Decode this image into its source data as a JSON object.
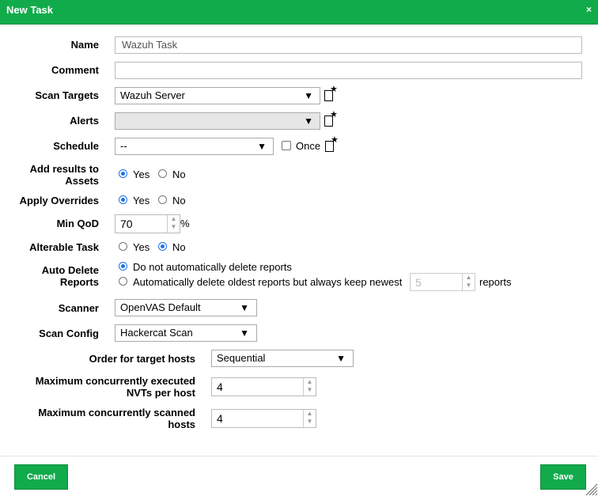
{
  "dialog": {
    "title": "New Task",
    "close_glyph": "×"
  },
  "form": {
    "name": {
      "label": "Name",
      "value": "Wazuh Task"
    },
    "comment": {
      "label": "Comment",
      "value": ""
    },
    "scan_targets": {
      "label": "Scan Targets",
      "selected": "Wazuh Server"
    },
    "alerts": {
      "label": "Alerts",
      "selected": ""
    },
    "schedule": {
      "label": "Schedule",
      "selected": "--",
      "once_label": "Once",
      "once_checked": false
    },
    "add_results": {
      "label_line1": "Add results to",
      "label_line2": "Assets",
      "yes": "Yes",
      "no": "No",
      "selected": "Yes"
    },
    "apply_overrides": {
      "label": "Apply Overrides",
      "yes": "Yes",
      "no": "No",
      "selected": "Yes"
    },
    "min_qod": {
      "label": "Min QoD",
      "value": "70",
      "unit": "%"
    },
    "alterable_task": {
      "label": "Alterable Task",
      "yes": "Yes",
      "no": "No",
      "selected": "No"
    },
    "auto_delete": {
      "label_line1": "Auto Delete",
      "label_line2": "Reports",
      "option1": "Do not automatically delete reports",
      "option2": "Automatically delete oldest reports but always keep newest",
      "keep_value": "5",
      "suffix": "reports",
      "selected": "option1"
    },
    "scanner": {
      "label": "Scanner",
      "selected": "OpenVAS Default"
    },
    "scan_config": {
      "label": "Scan Config",
      "selected": "Hackercat Scan"
    },
    "order_hosts": {
      "label": "Order for target hosts",
      "selected": "Sequential"
    },
    "max_nvts": {
      "label_line1": "Maximum concurrently executed",
      "label_line2": "NVTs per host",
      "value": "4"
    },
    "max_hosts": {
      "label_line1": "Maximum concurrently scanned",
      "label_line2": "hosts",
      "value": "4"
    }
  },
  "buttons": {
    "cancel": "Cancel",
    "save": "Save"
  },
  "icons": {
    "dropdown": "▼",
    "new": "new-icon",
    "star": "★",
    "spin_up": "▲",
    "spin_down": "▼"
  },
  "colors": {
    "accent": "#11ab4b",
    "radio": "#1a73e8"
  }
}
